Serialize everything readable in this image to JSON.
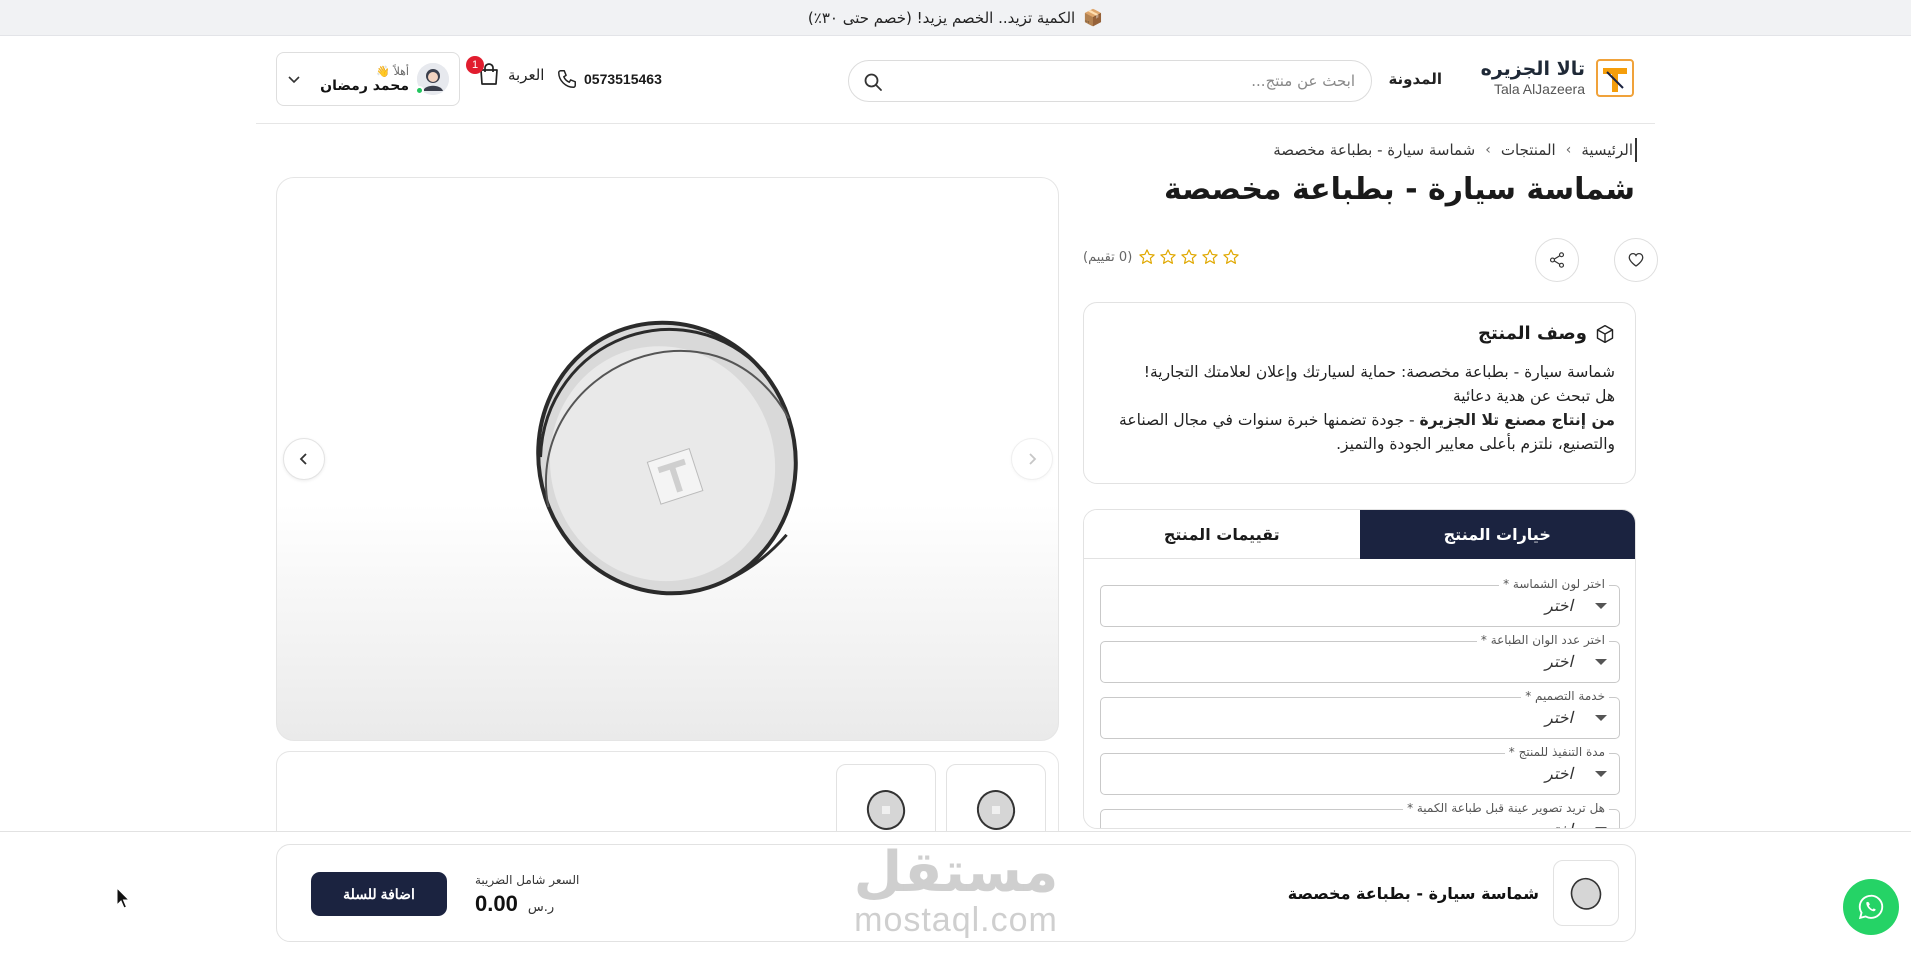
{
  "announcement": {
    "text": "الكمية تزيد.. الخصم يزيد! (خصم حتى ٣٠٪)",
    "icon": "package-icon"
  },
  "header": {
    "brand_ar": "تالا الجزيره",
    "brand_en": "Tala AlJazeera",
    "blog_label": "المدونة",
    "search_placeholder": "ابحث عن منتج...",
    "phone": "0573515463",
    "cart_label": "العربة",
    "cart_count": "1",
    "user_greeting": "أهلاً 👋",
    "user_name": "محمد رمضان"
  },
  "breadcrumb": {
    "home": "الرئيسية",
    "products": "المنتجات",
    "current": "شماسة سيارة - بطباعة مخصصة"
  },
  "product": {
    "title": "شماسة سيارة - بطباعة مخصصة",
    "rating_count": "(0 تقييم)",
    "rating": 0,
    "rating_max": 5
  },
  "description": {
    "heading": "وصف المنتج",
    "line1": "شماسة سيارة - بطباعة مخصصة: حماية لسيارتك وإعلان لعلامتك التجارية!",
    "line2": "هل تبحث عن هدية دعائية",
    "line3_bold": "من إنتاج مصنع تلا الجزيرة",
    "line3_rest": " - جودة تضمنها خبرة سنوات في مجال الصناعة والتصنيع، نلتزم بأعلى معايير الجودة والتميز."
  },
  "tabs": {
    "options": "خيارات المنتج",
    "reviews": "تقييمات المنتج"
  },
  "options": [
    {
      "label": "اختر لون الشماسة *",
      "value": "اختر"
    },
    {
      "label": "اختر عدد الوان الطباعة *",
      "value": "اختر"
    },
    {
      "label": "خدمة التصميم *",
      "value": "اختر"
    },
    {
      "label": "مدة التنفيذ للمنتج *",
      "value": "اختر"
    },
    {
      "label": "هل تريد تصوير عينة قبل طباعة الكمية *",
      "value": "اختر"
    }
  ],
  "sticky": {
    "add_to_cart": "اضافة للسلة",
    "price_label": "السعر شامل الضريبة",
    "price": "0.00",
    "currency": "ر.س",
    "product_name": "شماسة سيارة - بطباعة مخصصة"
  },
  "watermark": {
    "ar": "مستقل",
    "en": "mostaql.com"
  },
  "colors": {
    "primary": "#1b2340",
    "badge": "#e11d2e",
    "whatsapp": "#25d366",
    "online": "#22c55e"
  }
}
